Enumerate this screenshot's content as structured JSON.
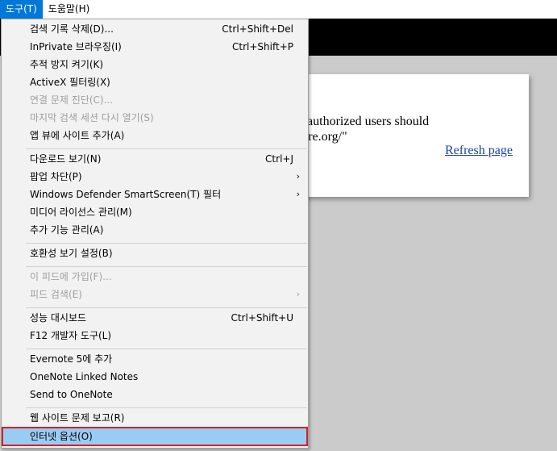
{
  "menubar": {
    "items": [
      {
        "label": "도구(T)",
        "active": true
      },
      {
        "label": "도움말(H)",
        "active": false
      }
    ]
  },
  "page": {
    "line1": "om \"\" while authorized users should",
    "line2": "ps.overthewire.org/\"",
    "refresh_link": "Refresh page"
  },
  "dropdown": {
    "items": [
      {
        "label": "검색 기록 삭제(D)...",
        "shortcut": "Ctrl+Shift+Del"
      },
      {
        "label": "InPrivate 브라우징(I)",
        "shortcut": "Ctrl+Shift+P"
      },
      {
        "label": "추적 방지 켜기(K)"
      },
      {
        "label": "ActiveX 필터링(X)"
      },
      {
        "label": "연결 문제 진단(C)...",
        "disabled": true
      },
      {
        "label": "마지막 검색 세션 다시 열기(S)",
        "disabled": true
      },
      {
        "label": "앱 뷰에 사이트 추가(A)"
      },
      {
        "label": "다운로드 보기(N)",
        "shortcut": "Ctrl+J"
      },
      {
        "label": "팝업 차단(P)",
        "submenu": true
      },
      {
        "label": "Windows Defender SmartScreen(T) 필터",
        "submenu": true
      },
      {
        "label": "미디어 라이선스 관리(M)"
      },
      {
        "label": "추가 기능 관리(A)"
      },
      {
        "label": "호환성 보기 설정(B)"
      },
      {
        "label": "이 피드에 가입(F)...",
        "disabled": true
      },
      {
        "label": "피드 검색(E)",
        "disabled": true,
        "submenu": true
      },
      {
        "label": "성능 대시보드",
        "shortcut": "Ctrl+Shift+U"
      },
      {
        "label": "F12 개발자 도구(L)"
      },
      {
        "label": "Evernote 5에 추가"
      },
      {
        "label": "OneNote Linked Notes"
      },
      {
        "label": "Send to OneNote"
      },
      {
        "label": "웹 사이트 문제 보고(R)"
      },
      {
        "label": "인터넷 옵션(O)",
        "highlighted": true
      }
    ],
    "submenu_arrow": "›"
  },
  "colors": {
    "menu_active": "#0078d7",
    "highlight_fill": "#99ccf3",
    "highlight_border": "#d61f26",
    "link": "#1c3fa8"
  }
}
